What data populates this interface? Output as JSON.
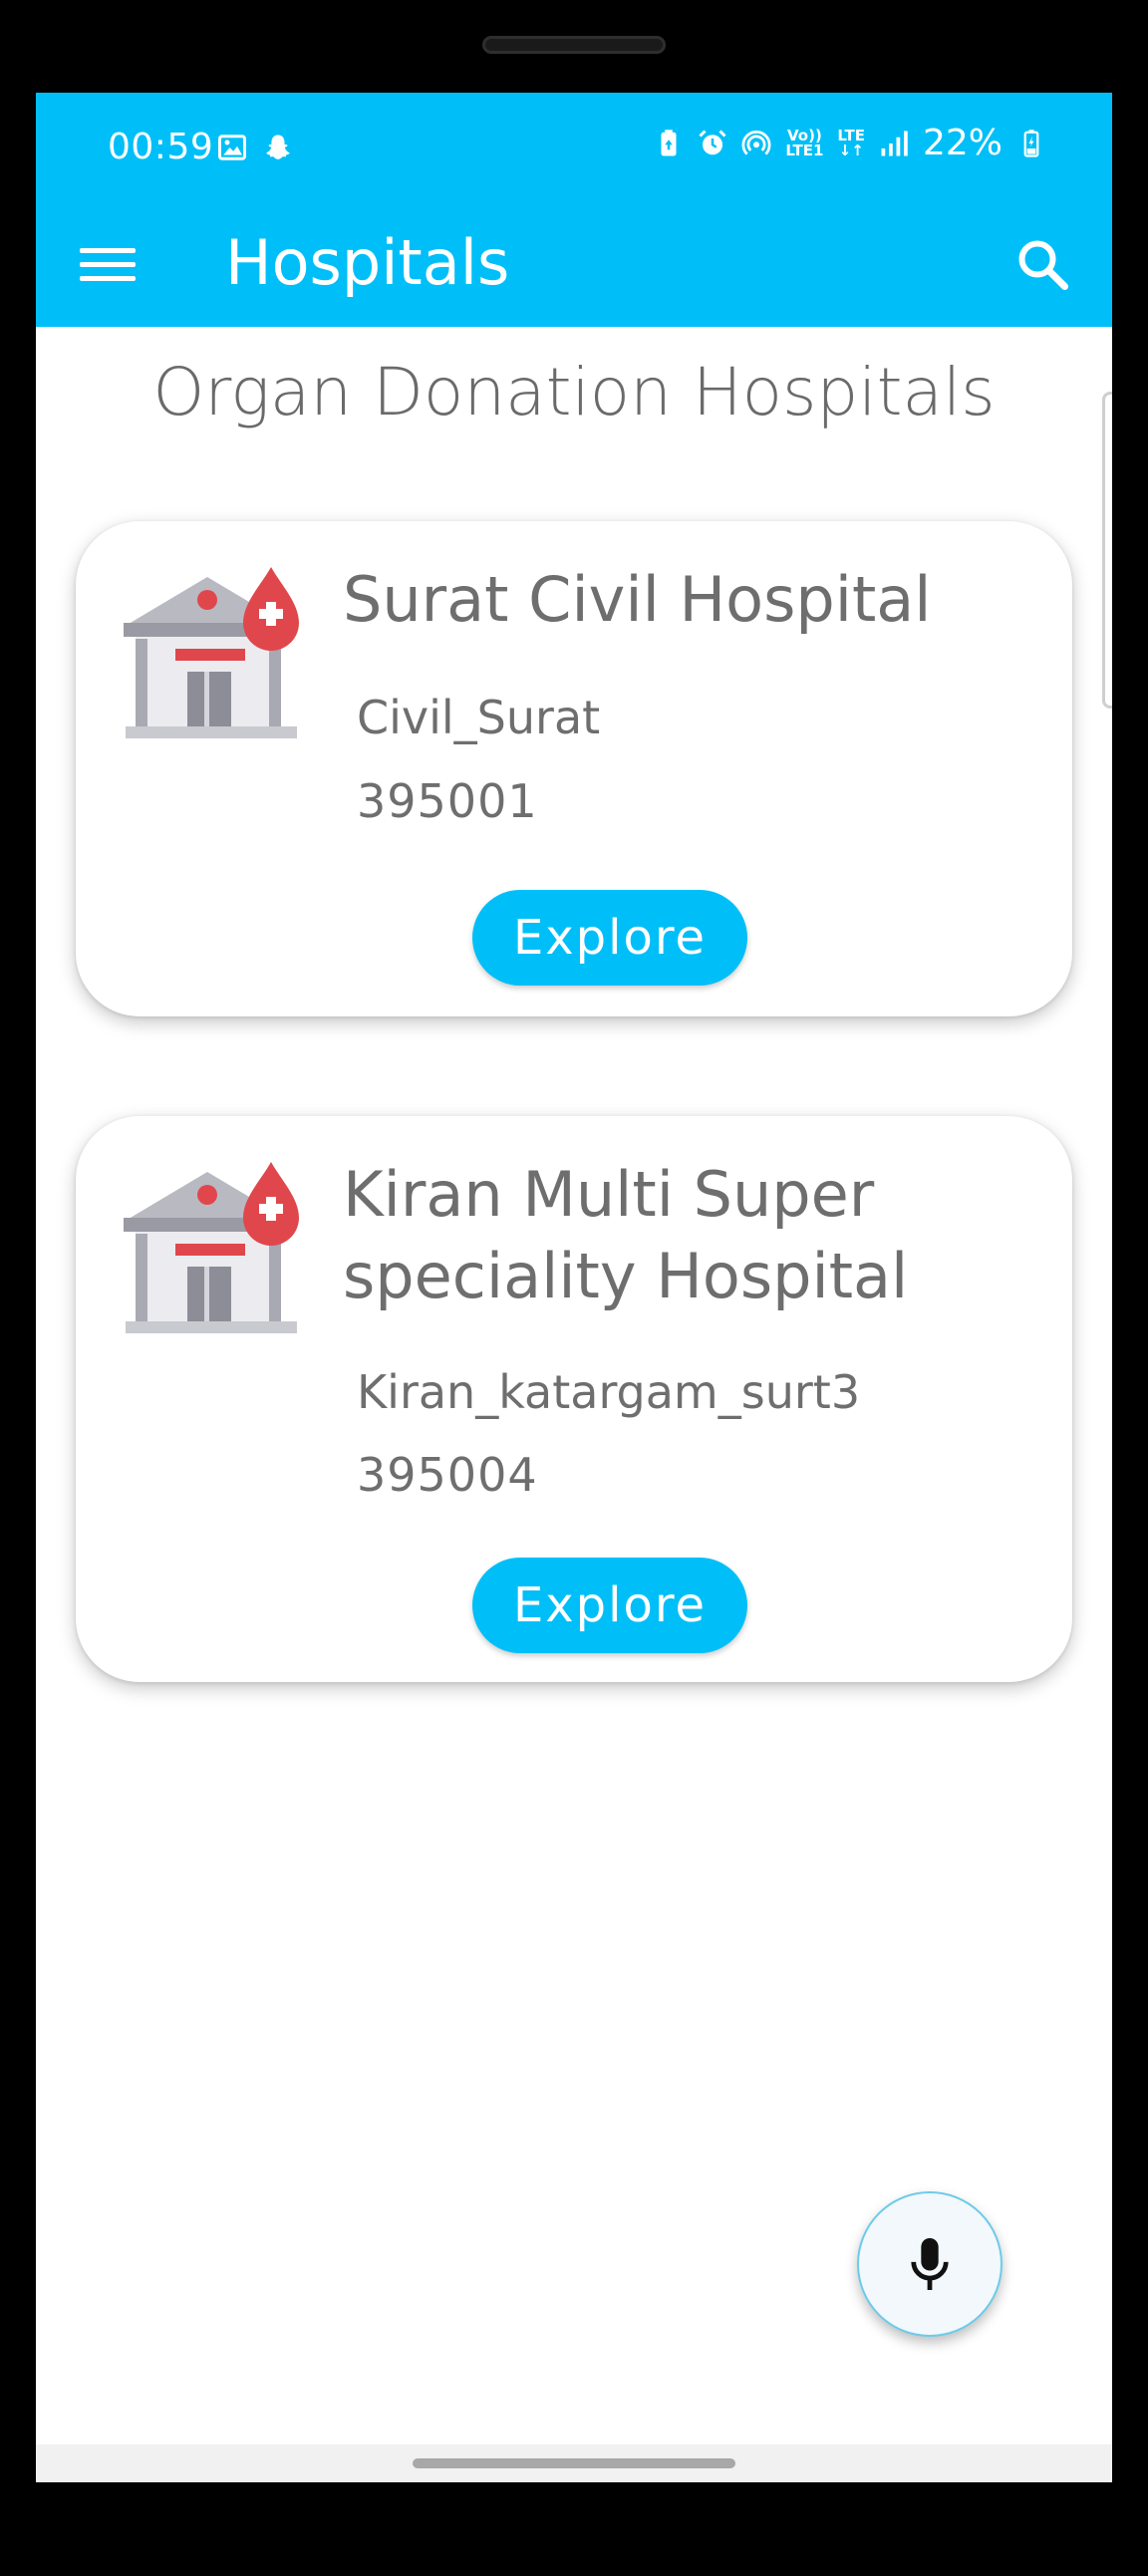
{
  "status_bar": {
    "time": "00:59",
    "network_top": "Vo))",
    "network_bottom": "LTE1",
    "lte_label": "LTE",
    "battery": "22%",
    "left_icons": [
      "image-icon",
      "snapchat-icon"
    ],
    "right_icons": [
      "battery-saver-icon",
      "alarm-icon",
      "hotspot-icon",
      "volte-icon",
      "lte-icon",
      "signal-icon",
      "battery-charging-icon"
    ]
  },
  "app_bar": {
    "title": "Hospitals",
    "menu_icon": "hamburger-menu-icon",
    "search_icon": "search-icon"
  },
  "page": {
    "heading": "Organ Donation Hospitals"
  },
  "hospitals": [
    {
      "name": "Surat Civil Hospital",
      "area": "Civil_Surat",
      "pincode": "395001",
      "button": "Explore",
      "icon": "hospital-blood-drop-icon"
    },
    {
      "name": "Kiran Multi Super speciality Hospital",
      "area": "Kiran_katargam_surt3",
      "pincode": "395004",
      "button": "Explore",
      "icon": "hospital-blood-drop-icon"
    }
  ],
  "fab": {
    "icon": "microphone-icon"
  },
  "colors": {
    "primary": "#00BFF8",
    "text_gray": "#6e6e6e",
    "card_bg": "#ffffff",
    "drop_red": "#E0474C"
  }
}
